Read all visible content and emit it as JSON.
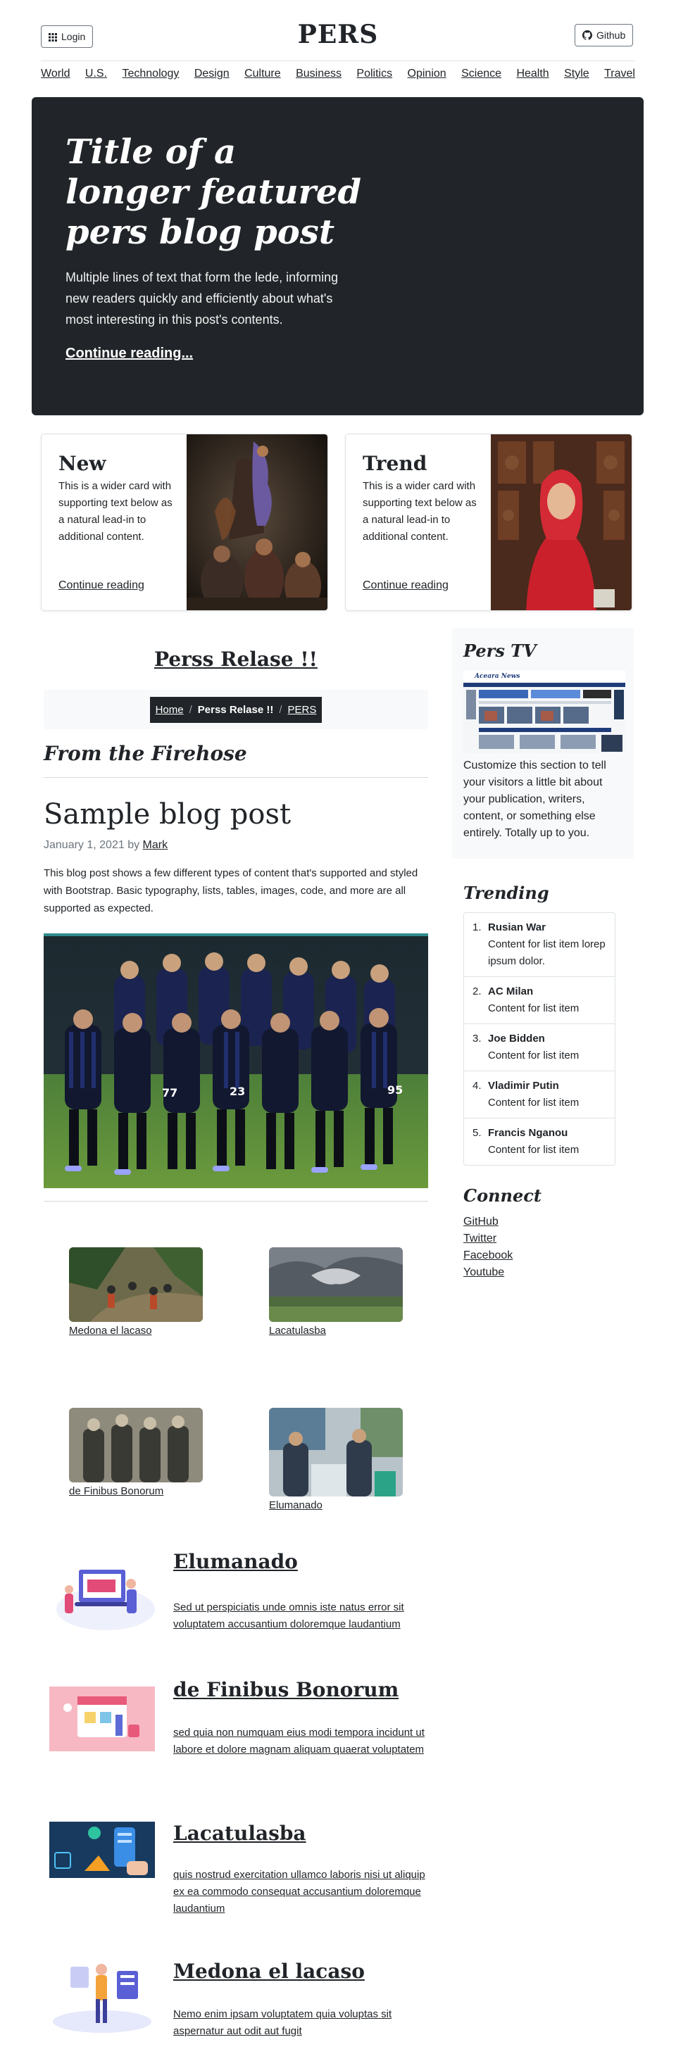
{
  "header": {
    "login_label": "Login",
    "brand": "PERS",
    "github_label": "Github"
  },
  "nav": [
    "World",
    "U.S.",
    "Technology",
    "Design",
    "Culture",
    "Business",
    "Politics",
    "Opinion",
    "Science",
    "Health",
    "Style",
    "Travel"
  ],
  "hero": {
    "title": "Title of a longer featured pers blog post",
    "lede": "Multiple lines of text that form the lede, informing new readers quickly and efficiently about what's most interesting in this post's contents.",
    "link": "Continue reading..."
  },
  "feature_cards": [
    {
      "title": "New",
      "text": "This is a wider card with supporting text below as a natural lead-in to additional content.",
      "link": "Continue reading"
    },
    {
      "title": "Trend",
      "text": "This is a wider card with supporting text below as a natural lead-in to additional content.",
      "link": "Continue reading"
    }
  ],
  "section": {
    "title": "Perss Relase !!",
    "breadcrumb": [
      "Home",
      "Perss Relase !!",
      "PERS"
    ],
    "subtitle": "From the Firehose"
  },
  "post": {
    "title": "Sample blog post",
    "date": "January 1, 2021 by",
    "author": "Mark",
    "body": "This blog post shows a few different types of content that's supported and styled with Bootstrap. Basic typography, lists, tables, images, code, and more are all supported as expected."
  },
  "thumbs": [
    "Medona el lacaso",
    "Lacatulasba",
    "de Finibus Bonorum",
    "Elumanado"
  ],
  "articles": [
    {
      "title": "Elumanado",
      "text": "Sed ut perspiciatis unde omnis iste natus error sit voluptatem accusantium doloremque laudantium"
    },
    {
      "title": "de Finibus Bonorum",
      "text": "sed quia non numquam eius modi tempora incidunt ut labore et dolore magnam aliquam quaerat voluptatem"
    },
    {
      "title": "Lacatulasba",
      "text": "quis nostrud exercitation ullamco laboris nisi ut aliquip ex ea commodo consequat accusantium doloremque laudantium"
    },
    {
      "title": "Medona el lacaso",
      "text": "Nemo enim ipsam voluptatem quia voluptas sit aspernatur aut odit aut fugit"
    }
  ],
  "sidebar": {
    "tv_title": "Pers TV",
    "tv_text": "Customize this section to tell your visitors a little bit about your publication, writers, content, or something else entirely. Totally up to you.",
    "tv_screenshot_brand": "Aceara News",
    "trending_title": "Trending",
    "trending": [
      {
        "title": "Rusian War",
        "text": "Content for list item lorep ipsum dolor."
      },
      {
        "title": "AC Milan",
        "text": "Content for list item"
      },
      {
        "title": "Joe Bidden",
        "text": "Content for list item"
      },
      {
        "title": "Vladimir Putin",
        "text": "Content for list item"
      },
      {
        "title": "Francis Nganou",
        "text": "Content for list item"
      }
    ],
    "connect_title": "Connect",
    "connect": [
      "GitHub",
      "Twitter",
      "Facebook",
      "Youtube"
    ]
  },
  "team_jersey_numbers": [
    "77",
    "23",
    "95"
  ]
}
